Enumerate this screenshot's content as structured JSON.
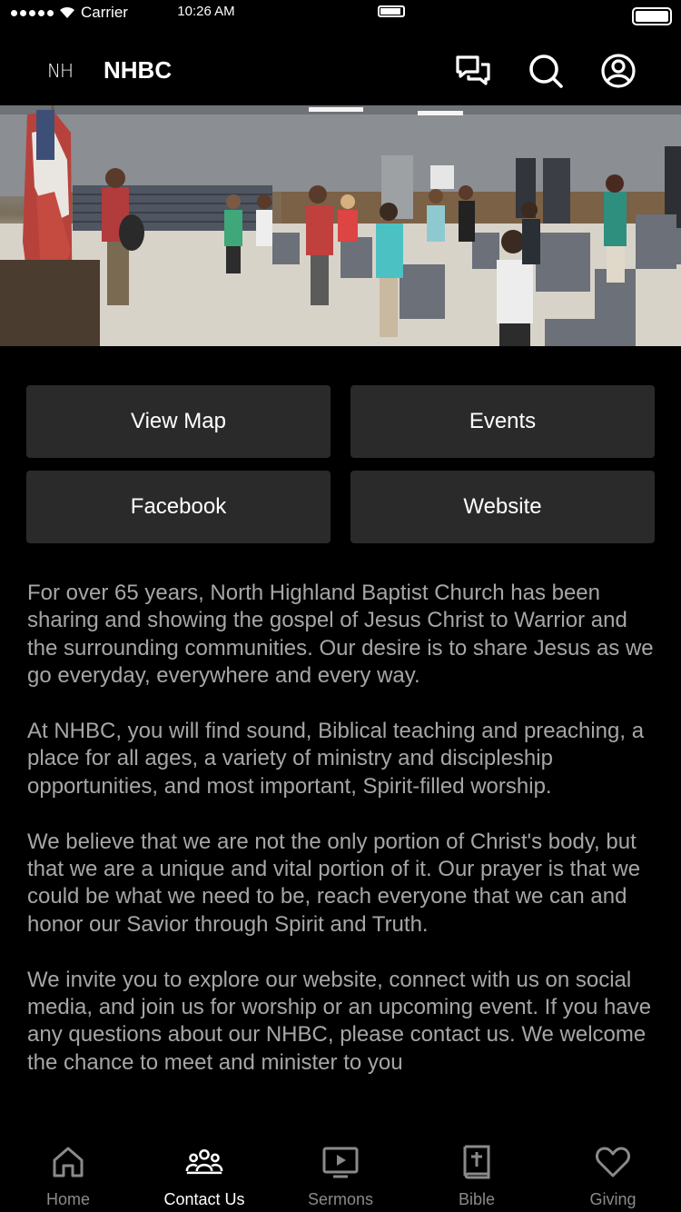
{
  "status_bar": {
    "carrier": "Carrier",
    "time": "10:26 AM"
  },
  "header": {
    "logo": "NH",
    "title": "NHBC"
  },
  "buttons": {
    "view_map": "View Map",
    "events": "Events",
    "facebook": "Facebook",
    "website": "Website"
  },
  "content": {
    "paragraphs": [
      "For over 65 years, North Highland Baptist Church has been sharing and showing the gospel of Jesus Christ to Warrior and the surrounding communities. Our desire is to share Jesus as we go everyday, everywhere and every way.",
      "At NHBC, you will find sound, Biblical teaching and preaching, a place for all ages, a variety of ministry and discipleship opportunities, and most important, Spirit-filled worship.",
      "We believe that we are not the only portion of Christ's body, but that we are a unique and vital portion of it. Our prayer is that we could be what we need to be, reach everyone that we can and honor our Savior through Spirit and Truth.",
      "We invite you to explore our website, connect with us on social media, and join us for worship or an upcoming event. If you have any questions about our NHBC, please contact us. We welcome the chance to meet and minister to you"
    ]
  },
  "tabs": [
    {
      "label": "Home",
      "icon": "home-icon",
      "active": false
    },
    {
      "label": "Contact Us",
      "icon": "people-icon",
      "active": true
    },
    {
      "label": "Sermons",
      "icon": "tv-play-icon",
      "active": false
    },
    {
      "label": "Bible",
      "icon": "bible-icon",
      "active": false
    },
    {
      "label": "Giving",
      "icon": "heart-icon",
      "active": false
    }
  ],
  "colors": {
    "background": "#000000",
    "button": "#2a2a2a",
    "body_text": "#a6a6a6",
    "tab_inactive": "#8a8a8a"
  }
}
